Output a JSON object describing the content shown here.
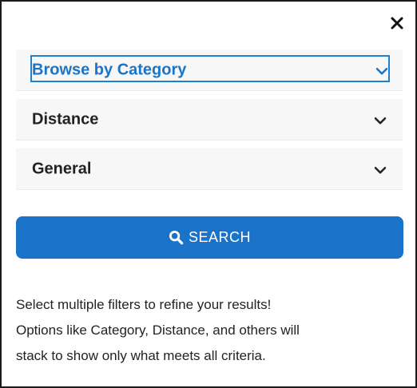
{
  "close": {
    "icon": "close-icon"
  },
  "filters": [
    {
      "label": "Browse by Category",
      "icon": "chevron-down-icon",
      "focused": true
    },
    {
      "label": "Distance",
      "icon": "chevron-down-icon"
    },
    {
      "label": "General",
      "icon": "chevron-down-icon"
    }
  ],
  "search_button": {
    "label": "SEARCH",
    "icon": "search-icon",
    "color": "#1a73c8"
  },
  "help_text": [
    "Select multiple filters to refine your results!",
    "Options like Category, Distance, and others will",
    "stack to show only what meets all criteria."
  ],
  "colors": {
    "accent": "#1b74c5",
    "panel_bg": "#f7f7f7"
  }
}
